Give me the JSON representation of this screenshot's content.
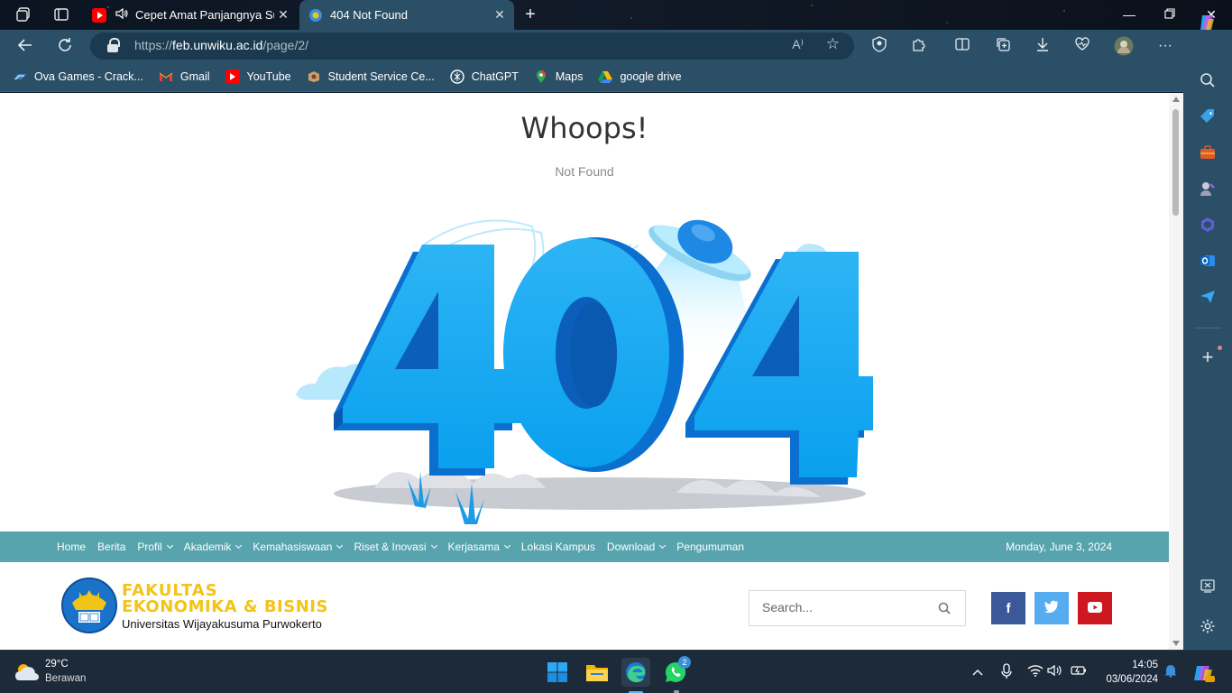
{
  "browser": {
    "tabs": [
      {
        "title": "Cepet Amat Panjangnya Su"
      },
      {
        "title": "404 Not Found"
      }
    ],
    "url_prefix": "https://",
    "url_host": "feb.unwiku.ac.id",
    "url_path": "/page/2/",
    "bookmarks": [
      {
        "label": "Ova Games - Crack...",
        "icon": "ova-icon",
        "color": "#3b82c4"
      },
      {
        "label": "Gmail",
        "icon": "gmail-icon",
        "color": "#ea4335"
      },
      {
        "label": "YouTube",
        "icon": "youtube-icon",
        "color": "#ff0000"
      },
      {
        "label": "Student Service Ce...",
        "icon": "student-service-icon",
        "color": "#c9a06a"
      },
      {
        "label": "ChatGPT",
        "icon": "chatgpt-icon",
        "color": "#ffffff"
      },
      {
        "label": "Maps",
        "icon": "maps-icon",
        "color": "#34a853"
      },
      {
        "label": "google drive",
        "icon": "drive-icon",
        "color": "#fbbc04"
      }
    ]
  },
  "page": {
    "heading": "Whoops!",
    "subheading": "Not Found",
    "big_number": "404",
    "nav_items": [
      {
        "label": "Home",
        "dropdown": false
      },
      {
        "label": "Berita",
        "dropdown": false
      },
      {
        "label": "Profil",
        "dropdown": true
      },
      {
        "label": "Akademik",
        "dropdown": true
      },
      {
        "label": "Kemahasiswaan",
        "dropdown": true
      },
      {
        "label": "Riset & Inovasi",
        "dropdown": true
      },
      {
        "label": "Kerjasama",
        "dropdown": true
      },
      {
        "label": "Lokasi Kampus",
        "dropdown": false
      },
      {
        "label": "Download",
        "dropdown": true
      },
      {
        "label": "Pengumuman",
        "dropdown": false
      }
    ],
    "date": "Monday, June 3, 2024",
    "logo_line1": "FAKULTAS",
    "logo_line2": "EKONOMIKA & BISNIS",
    "logo_line3": "Universitas Wijayakusuma Purwokerto",
    "search_placeholder": "Search...",
    "social": [
      {
        "name": "facebook",
        "glyph": "f",
        "color": "#3b5998"
      },
      {
        "name": "twitter",
        "glyph": "t",
        "color": "#55acee"
      },
      {
        "name": "youtube",
        "glyph": "▶",
        "color": "#cc181e"
      }
    ],
    "colors": {
      "nav": "#58a4ae",
      "accent": "#1a8fe0"
    }
  },
  "taskbar": {
    "temperature": "29°C",
    "weather": "Berawan",
    "time": "14:05",
    "date": "03/06/2024",
    "whatsapp_badge": "2"
  }
}
